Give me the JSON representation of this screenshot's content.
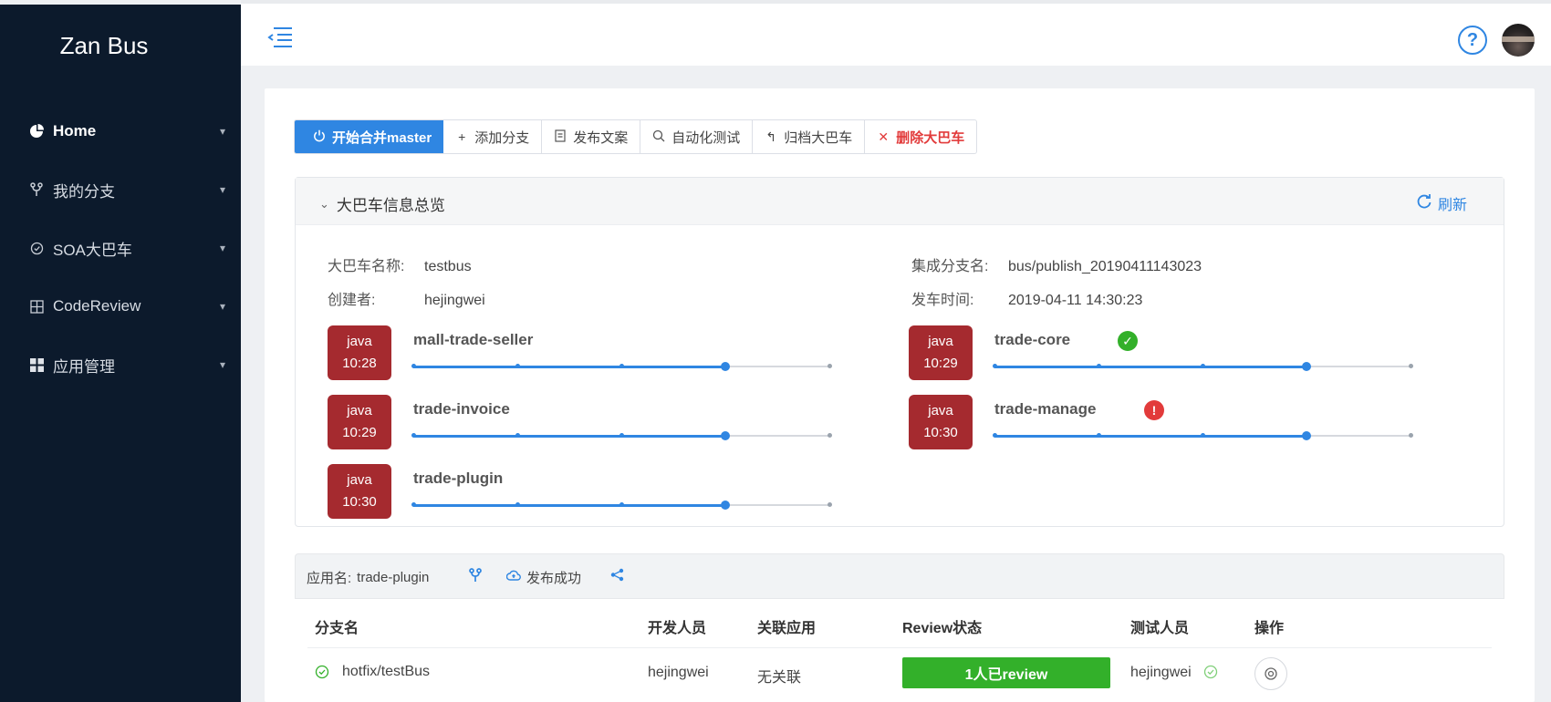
{
  "app": {
    "brand": "Zan Bus"
  },
  "sidebar": {
    "items": [
      {
        "label": "Home",
        "icon": "pie-chart-icon",
        "active": true
      },
      {
        "label": "我的分支",
        "icon": "branch-icon",
        "active": false
      },
      {
        "label": "SOA大巴车",
        "icon": "shield-check-icon",
        "active": false
      },
      {
        "label": "CodeReview",
        "icon": "grid-icon",
        "active": false
      },
      {
        "label": "应用管理",
        "icon": "apps-icon",
        "active": false
      }
    ]
  },
  "header": {
    "help_icon": "question-circle-icon",
    "avatar_icon": "user-avatar"
  },
  "toolbar": {
    "buttons": [
      {
        "label": "开始合并master",
        "icon": "power-icon"
      },
      {
        "label": "添加分支",
        "icon": "plus-icon"
      },
      {
        "label": "发布文案",
        "icon": "document-icon"
      },
      {
        "label": "自动化测试",
        "icon": "search-icon"
      },
      {
        "label": "归档大巴车",
        "icon": "undo-icon"
      },
      {
        "label": "删除大巴车",
        "icon": "close-icon"
      }
    ]
  },
  "overview": {
    "title": "大巴车信息总览",
    "refresh_label": "刷新",
    "fields": {
      "bus_name_label": "大巴车名称:",
      "bus_name": "testbus",
      "creator_label": "创建者:",
      "creator": "hejingwei",
      "branch_label": "集成分支名:",
      "branch": "bus/publish_20190411143023",
      "time_label": "发车时间:",
      "time": "2019-04-11 14:30:23"
    },
    "jobs": [
      {
        "lang": "java",
        "time": "10:28",
        "name": "mall-trade-seller",
        "status": "",
        "progress": 0.75
      },
      {
        "lang": "java",
        "time": "10:29",
        "name": "trade-core",
        "status": "success",
        "progress": 0.75
      },
      {
        "lang": "java",
        "time": "10:29",
        "name": "trade-invoice",
        "status": "",
        "progress": 0.75
      },
      {
        "lang": "java",
        "time": "10:30",
        "name": "trade-manage",
        "status": "error",
        "progress": 0.75
      },
      {
        "lang": "java",
        "time": "10:30",
        "name": "trade-plugin",
        "status": "",
        "progress": 0.75
      }
    ],
    "success_glyph": "✓",
    "error_glyph": "!"
  },
  "app_section": {
    "app_label": "应用名:",
    "app_name": "trade-plugin",
    "publish_status": "发布成功",
    "columns": [
      "分支名",
      "开发人员",
      "关联应用",
      "Review状态",
      "测试人员",
      "操作"
    ],
    "rows": [
      {
        "branch": "hotfix/testBus",
        "developer": "hejingwei",
        "related": "无关联",
        "review": "1人已review",
        "tester": "hejingwei"
      }
    ]
  },
  "colors": {
    "accent": "#2f86e2",
    "sidebar_bg": "#0c1a2c",
    "badge": "#a52a2f",
    "success": "#33b02a",
    "danger": "#e23b3b"
  }
}
